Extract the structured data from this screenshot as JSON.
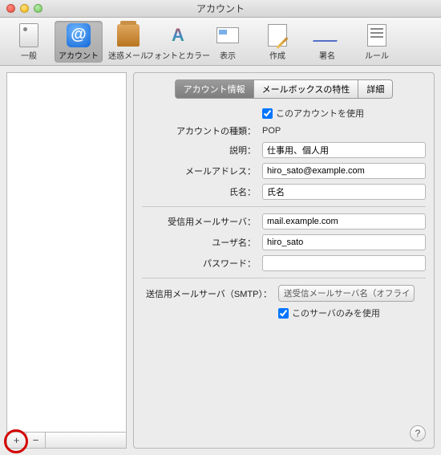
{
  "window": {
    "title": "アカウント"
  },
  "toolbar": {
    "items": [
      {
        "id": "general",
        "label": "一般"
      },
      {
        "id": "accounts",
        "label": "アカウント"
      },
      {
        "id": "junk",
        "label": "迷惑メール"
      },
      {
        "id": "fonts",
        "label": "フォントとカラー"
      },
      {
        "id": "viewing",
        "label": "表示"
      },
      {
        "id": "compose",
        "label": "作成"
      },
      {
        "id": "sign",
        "label": "署名"
      },
      {
        "id": "rules",
        "label": "ルール"
      }
    ],
    "selected": "accounts"
  },
  "tabs": {
    "items": [
      {
        "id": "info",
        "label": "アカウント情報"
      },
      {
        "id": "mailbox",
        "label": "メールボックスの特性"
      },
      {
        "id": "detail",
        "label": "詳細"
      }
    ],
    "active": "info"
  },
  "form": {
    "enable_label": "このアカウントを使用",
    "enable_checked": true,
    "type_label": "アカウントの種類：",
    "type_value": "POP",
    "desc_label": "説明：",
    "desc_value": "仕事用、個人用",
    "email_label": "メールアドレス：",
    "email_value": "hiro_sato@example.com",
    "name_label": "氏名：",
    "name_value": "氏名",
    "incoming_label": "受信用メールサーバ：",
    "incoming_value": "mail.example.com",
    "user_label": "ユーザ名：",
    "user_value": "hiro_sato",
    "pass_label": "パスワード：",
    "pass_value": "",
    "smtp_label": "送信用メールサーバ（SMTP）：",
    "smtp_selected": "送受信メールサーバ名（オフライ",
    "smtp_only_label": "このサーバのみを使用",
    "smtp_only_checked": true
  },
  "sidebar_buttons": {
    "add": "+",
    "remove": "−"
  },
  "help": "?"
}
